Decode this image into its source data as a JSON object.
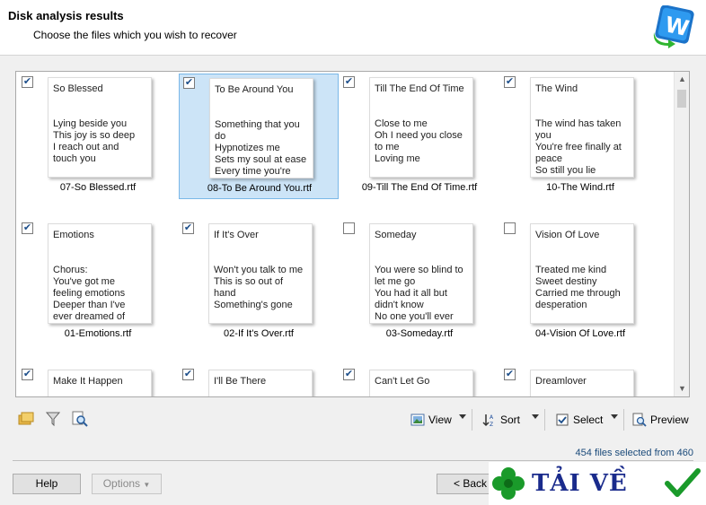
{
  "header": {
    "title": "Disk analysis results",
    "subtitle": "Choose the files which you wish to recover"
  },
  "files": [
    {
      "title": "So Blessed",
      "body": "Lying beside you\nThis joy is so deep\nI reach out and\ntouch you",
      "name": "07-So Blessed.rtf",
      "checked": true,
      "selected": false
    },
    {
      "title": "To Be Around You",
      "body": "Something that you\ndo\nHypnotizes me\nSets my soul at ease\nEvery time you're",
      "name": "08-To Be Around You.rtf",
      "checked": true,
      "selected": true
    },
    {
      "title": "Till The End Of Time",
      "body": "Close to me\nOh I need you close\nto me\nLoving me",
      "name": "09-Till The End Of Time.rtf",
      "checked": true,
      "selected": false
    },
    {
      "title": "The Wind",
      "body": "The wind has taken\nyou\nYou're free finally at\npeace\nSo still you lie",
      "name": "10-The Wind.rtf",
      "checked": true,
      "selected": false
    },
    {
      "title": "Emotions",
      "body": "Chorus:\nYou've got me\nfeeling emotions\nDeeper than I've\never dreamed of",
      "name": "01-Emotions.rtf",
      "checked": true,
      "selected": false
    },
    {
      "title": "If It's Over",
      "body": "Won't you talk to me\nThis is so out of\nhand\nSomething's gone",
      "name": "02-If It's Over.rtf",
      "checked": true,
      "selected": false
    },
    {
      "title": "Someday",
      "body": "You were so blind to\nlet me go\nYou had it all but\ndidn't know\nNo one you'll ever",
      "name": "03-Someday.rtf",
      "checked": false,
      "selected": false
    },
    {
      "title": "Vision Of Love",
      "body": "Treated me kind\nSweet destiny\nCarried me through\ndesperation",
      "name": "04-Vision Of Love.rtf",
      "checked": false,
      "selected": false
    },
    {
      "title": "Make It Happen",
      "body": "",
      "name": "",
      "checked": true,
      "selected": false
    },
    {
      "title": "I'll Be There",
      "body": "",
      "name": "",
      "checked": true,
      "selected": false
    },
    {
      "title": "Can't Let Go",
      "body": "",
      "name": "",
      "checked": true,
      "selected": false
    },
    {
      "title": "Dreamlover",
      "body": "",
      "name": "",
      "checked": true,
      "selected": false
    }
  ],
  "toolbar": {
    "view_label": "View",
    "sort_label": "Sort",
    "select_label": "Select",
    "preview_label": "Preview"
  },
  "status": "454 files selected from 460",
  "buttons": {
    "help": "Help",
    "options": "Options",
    "back": "< Back"
  },
  "watermark": {
    "text": "TẢI VỀ"
  },
  "colors": {
    "selection_bg": "#cce4f7",
    "selection_border": "#7ab8e8",
    "status_text": "#1a4a7a",
    "watermark_text": "#1a2b8c",
    "clover_green": "#1a9a2a"
  }
}
